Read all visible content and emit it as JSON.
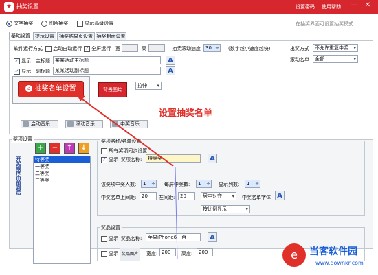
{
  "titlebar": {
    "title": "抽奖设置",
    "settings_password": "设置密码",
    "help": "使用帮助",
    "min": "—",
    "close": "✕",
    "app_icon": "gift-icon"
  },
  "mode": {
    "text": "文字抽奖",
    "image": "图片抽奖",
    "advanced": "显示高级设置",
    "hint": "在抽奖界面可设置抽奖模式"
  },
  "tabs": [
    "基础设置",
    "提示设置",
    "抽奖结果页设置",
    "抽奖封面设置"
  ],
  "run": {
    "label": "软件运行方式",
    "auto": "启动自动运行",
    "fullscreen": "全屏运行",
    "width": "宽",
    "height": "高",
    "speed_label": "抽奖滚动速度",
    "speed": "30",
    "speed_hint": "(数字越小速度越快)"
  },
  "titles": {
    "show": "显示",
    "main_label": "主标题",
    "main_value": "某某活动主标题",
    "sub_label": "副标题",
    "sub_value": "某某活动副标题"
  },
  "buttons": {
    "list_setup": "抽奖名单设置",
    "bg_image": "背景图片",
    "stretch": "拉伸",
    "start_music": "启动音乐",
    "roll_music": "滚动音乐",
    "win_music": "中奖音乐"
  },
  "right": {
    "out_label": "出奖方式",
    "out_value": "不允许重复中奖",
    "roll_label": "滚动名单",
    "roll_value": "全部"
  },
  "annotation": "设置抽奖名单",
  "prize": {
    "group_label": "奖项设置",
    "vertical": "开奖顺序由前到后",
    "items": [
      "特等奖",
      "一等奖",
      "二等奖",
      "三等奖"
    ]
  },
  "winner": {
    "group": "奖项名称/名单设置",
    "all_sync": "所有奖项同步设置",
    "show": "显示",
    "name_label": "奖项名称:",
    "name_value": "特等奖",
    "count_label": "该奖项中奖人数:",
    "count": "1",
    "per_label": "每屏中奖数:",
    "per": "1",
    "cols_label": "显示列数:",
    "cols": "1",
    "top_label": "中奖名单上间距:",
    "top": "20",
    "left_label": "左间距:",
    "left": "20",
    "align": "居中对齐",
    "font_label": "中奖名单字体",
    "ratio": "按比例显示"
  },
  "goods": {
    "group": "奖品设置",
    "show": "显示",
    "name_label": "奖品名称:",
    "name_value": "苹果iPhone6一台",
    "image_label": "奖品图片",
    "w_label": "宽度:",
    "w": "200",
    "h_label": "高度:",
    "h": "200"
  },
  "watermark": {
    "brand": "当客软件园",
    "url": "www.downkr.com"
  },
  "colors": {
    "titlebar": "#d6262e",
    "accent_red": "#e0302a",
    "brand_blue": "#1a5fd6"
  }
}
